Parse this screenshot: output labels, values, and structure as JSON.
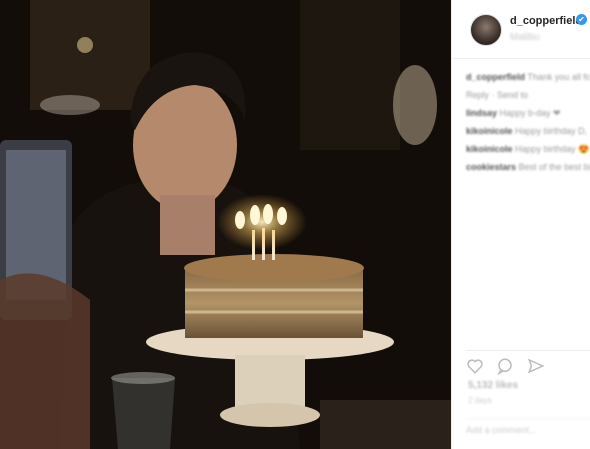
{
  "post": {
    "username": "d_copperfield",
    "verified_mark": "✔",
    "location": "Malibu",
    "comments": [
      {
        "user": "d_copperfield",
        "text": "Thank you all for the birthday wishes ♥"
      },
      {
        "user": "",
        "text": "Reply · Send to"
      },
      {
        "user": "lindsay",
        "text": "Happy b-day ❤"
      },
      {
        "user": "kikoinicole",
        "text": "Happy birthday D, magnificent one"
      },
      {
        "user": "kikoinicole",
        "text": "Happy birthday 😍"
      },
      {
        "user": "cookiestars",
        "text": "Best of the best birthday ☺☺"
      }
    ],
    "likes": "5,132 likes",
    "date": "2 days",
    "add_comment_placeholder": "Add a comment..."
  },
  "icons": {
    "like": "heart-icon",
    "comment": "comment-icon",
    "share": "share-icon",
    "verified": "verified-badge-icon"
  },
  "colors": {
    "verified_blue": "#3897f0",
    "text_dark": "#262626",
    "border": "#efefef"
  }
}
